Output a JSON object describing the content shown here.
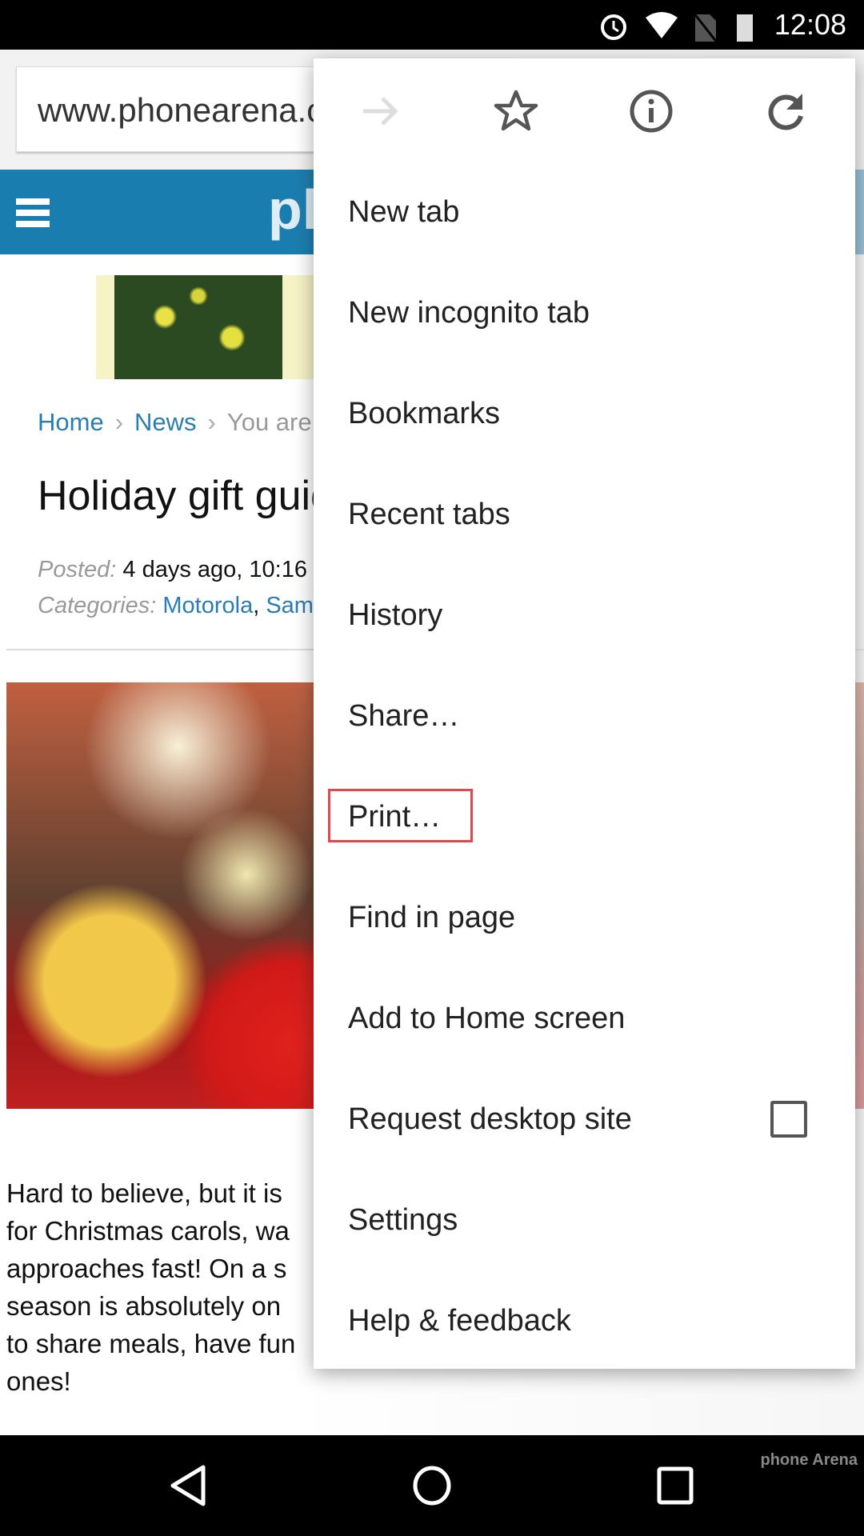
{
  "status_bar": {
    "time": "12:08",
    "battery": "33",
    "icons": [
      "alarm-icon",
      "wifi-icon",
      "no-sim-icon",
      "battery-icon"
    ]
  },
  "toolbar": {
    "url": "www.phonearena.com"
  },
  "site": {
    "logo": "phonearena"
  },
  "breadcrumb": {
    "items": [
      "Home",
      "News",
      "You are"
    ],
    "separator": "›"
  },
  "article": {
    "title": "Holiday gift guide",
    "posted_label": "Posted:",
    "posted_value": "4 days ago, 10:16",
    "categories_label": "Categories:",
    "categories": [
      "Motorola",
      "Samsung"
    ],
    "paragraph_lines": [
      "Hard to believe, but it is",
      "for Christmas carols, wa",
      "approaches fast! On a s",
      "season is absolutely on",
      "to share meals, have fun",
      "ones!"
    ]
  },
  "menu": {
    "icons": [
      "forward-icon",
      "star-icon",
      "info-icon",
      "reload-icon"
    ],
    "items": [
      "New tab",
      "New incognito tab",
      "Bookmarks",
      "Recent tabs",
      "History",
      "Share…",
      "Print…",
      "Find in page",
      "Add to Home screen",
      "Request desktop site",
      "Settings",
      "Help & feedback"
    ],
    "request_desktop_checked": false,
    "highlighted_item": "Print…",
    "highlight_color": "#e0484f"
  },
  "watermark": "phone Arena",
  "colors": {
    "site_blue": "#1a7db0",
    "link": "#2a7db0"
  }
}
